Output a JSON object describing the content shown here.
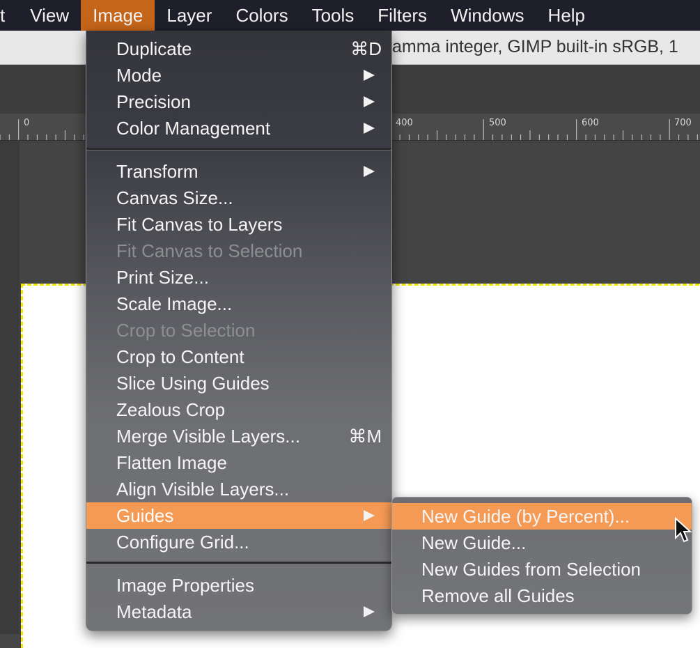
{
  "menubar": {
    "items": [
      {
        "label": "t"
      },
      {
        "label": "View"
      },
      {
        "label": "Image"
      },
      {
        "label": "Layer"
      },
      {
        "label": "Colors"
      },
      {
        "label": "Tools"
      },
      {
        "label": "Filters"
      },
      {
        "label": "Windows"
      },
      {
        "label": "Help"
      }
    ],
    "active_color": "#c5651a"
  },
  "infobar": {
    "text": "amma integer, GIMP built-in sRGB, 1"
  },
  "ruler": {
    "labels": [
      "0",
      "400",
      "500",
      "600",
      "700"
    ]
  },
  "image_menu": {
    "items": [
      {
        "label": "Duplicate",
        "shortcut": "⌘D"
      },
      {
        "label": "Mode",
        "submenu": true
      },
      {
        "label": "Precision",
        "submenu": true
      },
      {
        "label": "Color Management",
        "submenu": true
      },
      {
        "label": "Transform",
        "submenu": true
      },
      {
        "label": "Canvas Size..."
      },
      {
        "label": "Fit Canvas to Layers"
      },
      {
        "label": "Fit Canvas to Selection",
        "disabled": true
      },
      {
        "label": "Print Size..."
      },
      {
        "label": "Scale Image..."
      },
      {
        "label": "Crop to Selection",
        "disabled": true
      },
      {
        "label": "Crop to Content"
      },
      {
        "label": "Slice Using Guides"
      },
      {
        "label": "Zealous Crop"
      },
      {
        "label": "Merge Visible Layers...",
        "shortcut": "⌘M"
      },
      {
        "label": "Flatten Image"
      },
      {
        "label": "Align Visible Layers..."
      },
      {
        "label": "Guides",
        "submenu": true,
        "highlighted": true
      },
      {
        "label": "Configure Grid..."
      },
      {
        "label": "Image Properties"
      },
      {
        "label": "Metadata",
        "submenu": true
      }
    ]
  },
  "guides_submenu": {
    "items": [
      {
        "label": "New Guide (by Percent)...",
        "highlighted": true
      },
      {
        "label": "New Guide..."
      },
      {
        "label": "New Guides from Selection"
      },
      {
        "label": "Remove all Guides"
      }
    ]
  },
  "colors": {
    "highlight": "#f59a55",
    "menubar_bg": "#1e1f2a",
    "selection_border": "#f0e600"
  }
}
